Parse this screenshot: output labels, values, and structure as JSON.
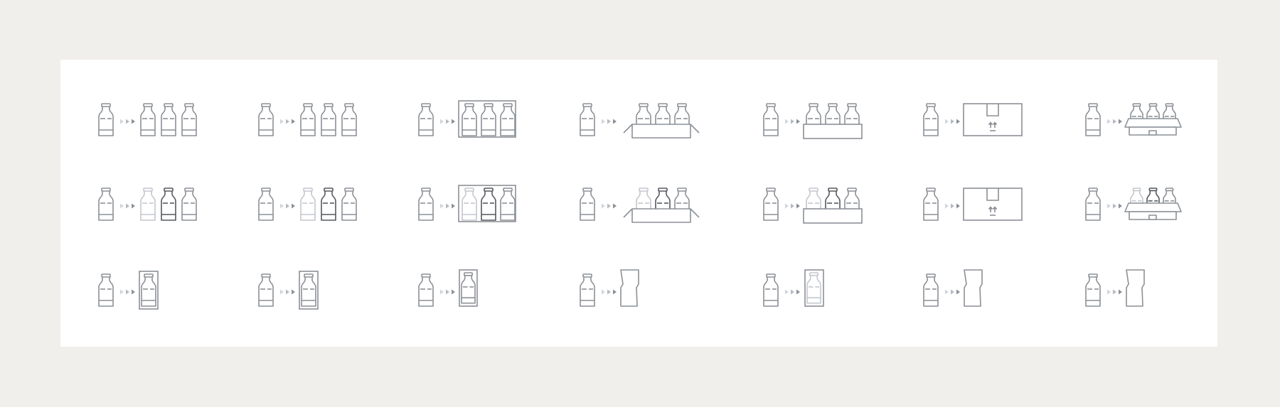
{
  "colors": {
    "page_background": "#f0efeb",
    "panel_background": "#ffffff",
    "stroke_default": "#8c9096",
    "stroke_faded": "#c3c7cd",
    "stroke_dark": "#55585d",
    "arrow_light": "#d3d6da",
    "arrow_mid": "#b6bac0",
    "arrow_dark": "#8c9096"
  },
  "icon_grid": {
    "rows": [
      {
        "name": "plain",
        "icons": [
          {
            "name": "bottle-to-three-bottles-icon",
            "target": "three-bottles",
            "highlight": "none"
          },
          {
            "name": "bottle-to-three-bottles-wide-icon",
            "target": "three-bottles",
            "highlight": "none"
          },
          {
            "name": "bottle-to-framed-pack-icon",
            "target": "framed-pack",
            "highlight": "none"
          },
          {
            "name": "bottle-to-open-box-icon",
            "target": "open-box",
            "highlight": "none"
          },
          {
            "name": "bottle-to-crate-icon",
            "target": "crate",
            "highlight": "none"
          },
          {
            "name": "bottle-to-shipping-box-icon",
            "target": "shipping-box",
            "highlight": "none"
          },
          {
            "name": "bottle-to-carrier-icon",
            "target": "carrier",
            "highlight": "none"
          }
        ]
      },
      {
        "name": "highlighted-middle",
        "icons": [
          {
            "name": "bottle-to-three-bottles-highlight-icon",
            "target": "three-bottles",
            "highlight": "middle"
          },
          {
            "name": "bottle-to-three-bottles-wide-highlight-icon",
            "target": "three-bottles",
            "highlight": "middle"
          },
          {
            "name": "bottle-to-framed-pack-highlight-icon",
            "target": "framed-pack",
            "highlight": "middle"
          },
          {
            "name": "bottle-to-open-box-highlight-icon",
            "target": "open-box",
            "highlight": "middle"
          },
          {
            "name": "bottle-to-crate-highlight-icon",
            "target": "crate",
            "highlight": "middle"
          },
          {
            "name": "bottle-to-shipping-box-highlight-icon",
            "target": "shipping-box",
            "highlight": "middle"
          },
          {
            "name": "bottle-to-carrier-highlight-icon",
            "target": "carrier",
            "highlight": "middle"
          }
        ]
      },
      {
        "name": "single",
        "icons": [
          {
            "name": "bottle-to-framed-bottle-icon",
            "target": "framed-bottle",
            "highlight": "none"
          },
          {
            "name": "bottle-to-framed-bottle-alt-icon",
            "target": "framed-bottle",
            "highlight": "none"
          },
          {
            "name": "bottle-to-boxed-bottle-icon",
            "target": "boxed-bottle",
            "highlight": "none"
          },
          {
            "name": "bottle-to-carton-icon",
            "target": "carton",
            "highlight": "none"
          },
          {
            "name": "bottle-to-boxed-faded-bottle-icon",
            "target": "boxed-faded-bottle",
            "highlight": "none"
          },
          {
            "name": "bottle-to-carton-alt-icon",
            "target": "carton",
            "highlight": "none"
          },
          {
            "name": "bottle-to-carton-second-alt-icon",
            "target": "carton",
            "highlight": "none"
          }
        ]
      }
    ]
  }
}
